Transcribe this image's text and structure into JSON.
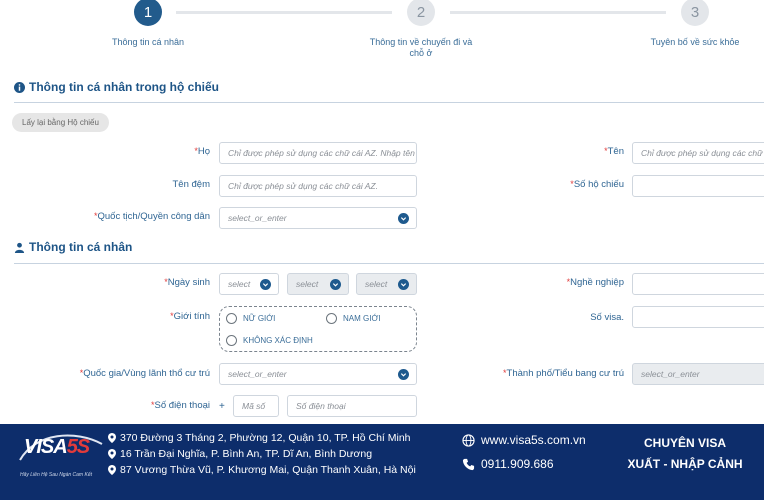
{
  "stepper": {
    "steps": [
      {
        "number": "1",
        "label": "Thông tin cá nhân"
      },
      {
        "number": "2",
        "label": "Thông tin về chuyến đi và chỗ ở"
      },
      {
        "number": "3",
        "label": "Tuyên bố về sức khỏe"
      }
    ]
  },
  "passport_section": {
    "title": "Thông tin cá nhân trong hộ chiếu",
    "reload_button": "Lấy lại bằng Hộ chiếu",
    "fields": {
      "ho": {
        "label": "Họ",
        "placeholder": "Chỉ được phép sử dụng các chữ cái AZ. Nhập tên"
      },
      "ten": {
        "label": "Tên",
        "placeholder": "Chỉ được phép sử dụng các chữ cái AZ."
      },
      "ten_dem": {
        "label": "Tên đệm",
        "placeholder": "Chỉ được phép sử dụng các chữ cái AZ."
      },
      "so_ho_chieu": {
        "label": "Số hộ chiếu",
        "placeholder": ""
      },
      "quoc_tich": {
        "label": "Quốc tịch/Quyền công dân",
        "placeholder": "select_or_enter"
      }
    }
  },
  "personal_section": {
    "title": "Thông tin cá nhân",
    "fields": {
      "ngay_sinh": {
        "label": "Ngày sinh",
        "day": "select",
        "month": "select",
        "year": "select"
      },
      "nghe_nghiep": {
        "label": "Nghề nghiệp",
        "placeholder": ""
      },
      "gioi_tinh": {
        "label": "Giới tính",
        "options": [
          "NỮ GIỚI",
          "NAM GIỚI",
          "KHÔNG XÁC ĐỊNH"
        ]
      },
      "so_visa": {
        "label": "Số visa.",
        "placeholder": ""
      },
      "quoc_gia_cu_tru": {
        "label": "Quốc gia/Vùng lãnh thổ cư trú",
        "placeholder": "select_or_enter"
      },
      "thanh_pho": {
        "label": "Thành phố/Tiểu bang cư trú",
        "placeholder": "select_or_enter"
      },
      "so_dien_thoai": {
        "label": "Số điện thoại",
        "plus": "+",
        "code_placeholder": "Mã số",
        "number_placeholder": "Số điện thoại"
      }
    }
  },
  "footer": {
    "logo": {
      "prefix": "VISA",
      "accent": "5S",
      "tagline": "Hãy Liên Hệ Sau Ngàn Cam Kết"
    },
    "addresses": [
      "370 Đường 3 Tháng 2, Phường 12, Quận 10, TP. Hồ Chí Minh",
      "16 Trần Đại Nghĩa, P. Bình An, TP. Dĩ An, Bình Dương",
      "87 Vương Thừa Vũ, P. Khương Mai, Quận Thanh Xuân, Hà Nội"
    ],
    "website": "www.visa5s.com.vn",
    "phone": "0911.909.686",
    "slogan_line1": "CHUYÊN VISA",
    "slogan_line2": "XUẤT - NHẬP CẢNH"
  },
  "colors": {
    "primary": "#225b8c",
    "footer_bg": "#0d2d6b",
    "required": "#e03c3c"
  }
}
